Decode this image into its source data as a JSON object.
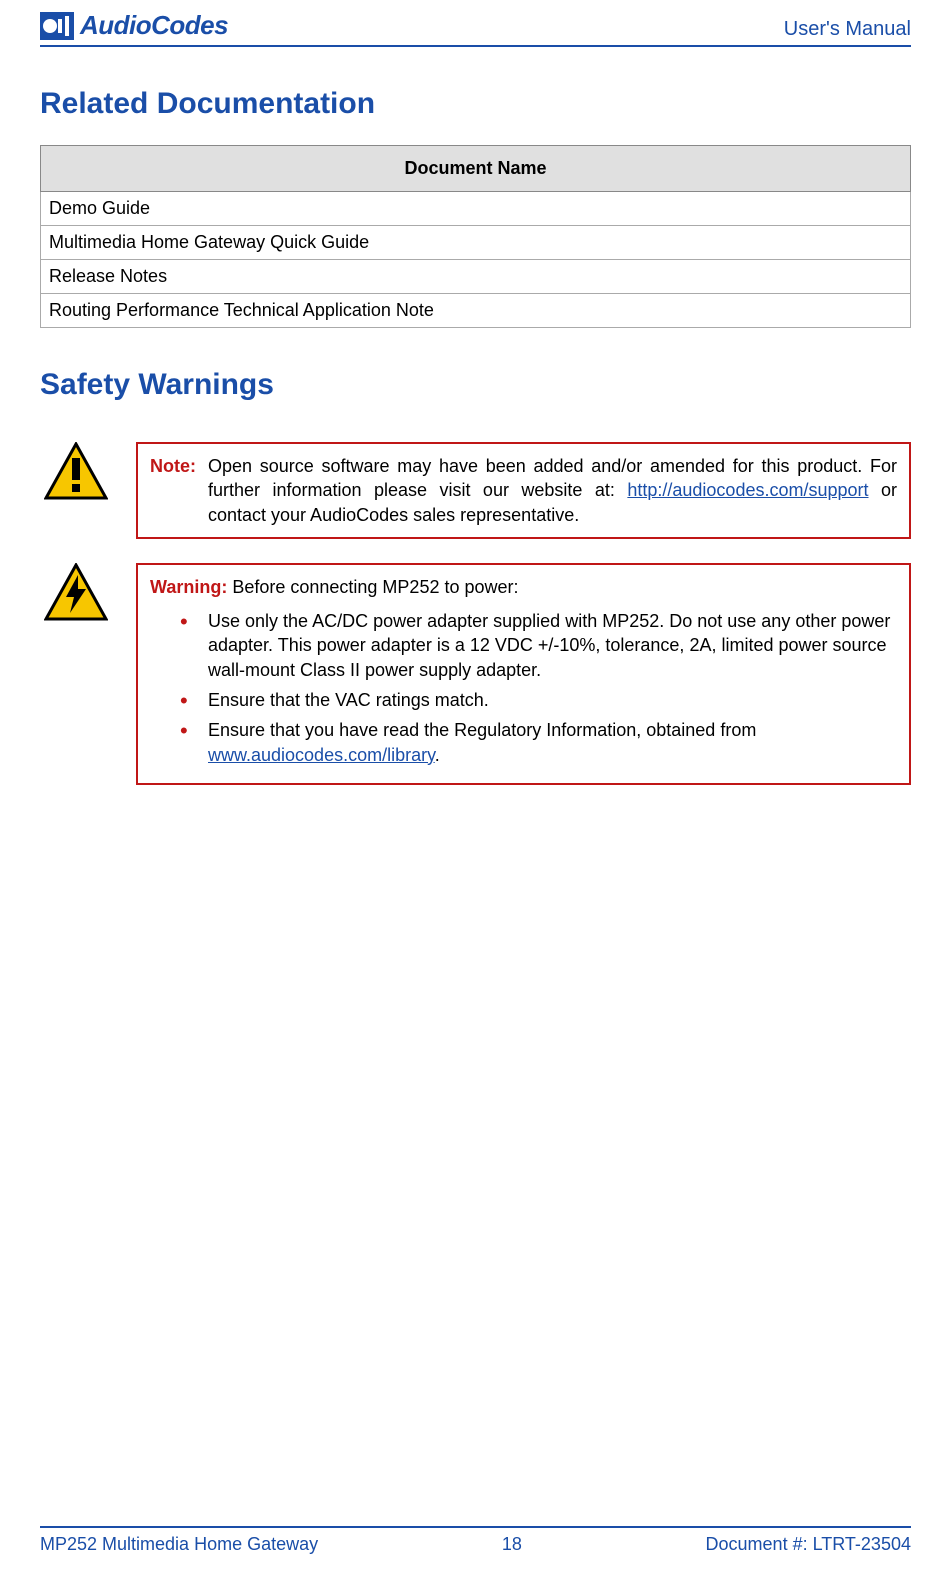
{
  "header": {
    "brand": "AudioCodes",
    "right_text": "User's Manual"
  },
  "sections": {
    "related_docs_heading": "Related Documentation",
    "safety_heading": "Safety Warnings"
  },
  "doc_table": {
    "header": "Document Name",
    "rows": [
      "Demo Guide",
      "Multimedia Home Gateway Quick Guide",
      "Release Notes",
      "Routing Performance Technical Application Note"
    ]
  },
  "note_box": {
    "label": "Note:",
    "text_before_link": "Open source software may have been added and/or amended for this product. For further information please visit our website at: ",
    "link_text": "http://audiocodes.com/support",
    "text_after_link": " or contact your AudioCodes sales representative."
  },
  "warning_box": {
    "label": "Warning:",
    "intro": " Before connecting MP252 to power:",
    "bullets": {
      "b1": "Use only the AC/DC power adapter supplied with MP252. Do not use any other power adapter. This power adapter is a 12 VDC +/-10%, tolerance, 2A, limited power source wall-mount Class II power supply adapter.",
      "b2": "Ensure that the VAC ratings match.",
      "b3_before": "Ensure that you have read the Regulatory Information, obtained from ",
      "b3_link": "www.audiocodes.com/library",
      "b3_after": "."
    }
  },
  "footer": {
    "left": "MP252 Multimedia Home Gateway",
    "center": "18",
    "right": "Document #: LTRT-23504"
  }
}
